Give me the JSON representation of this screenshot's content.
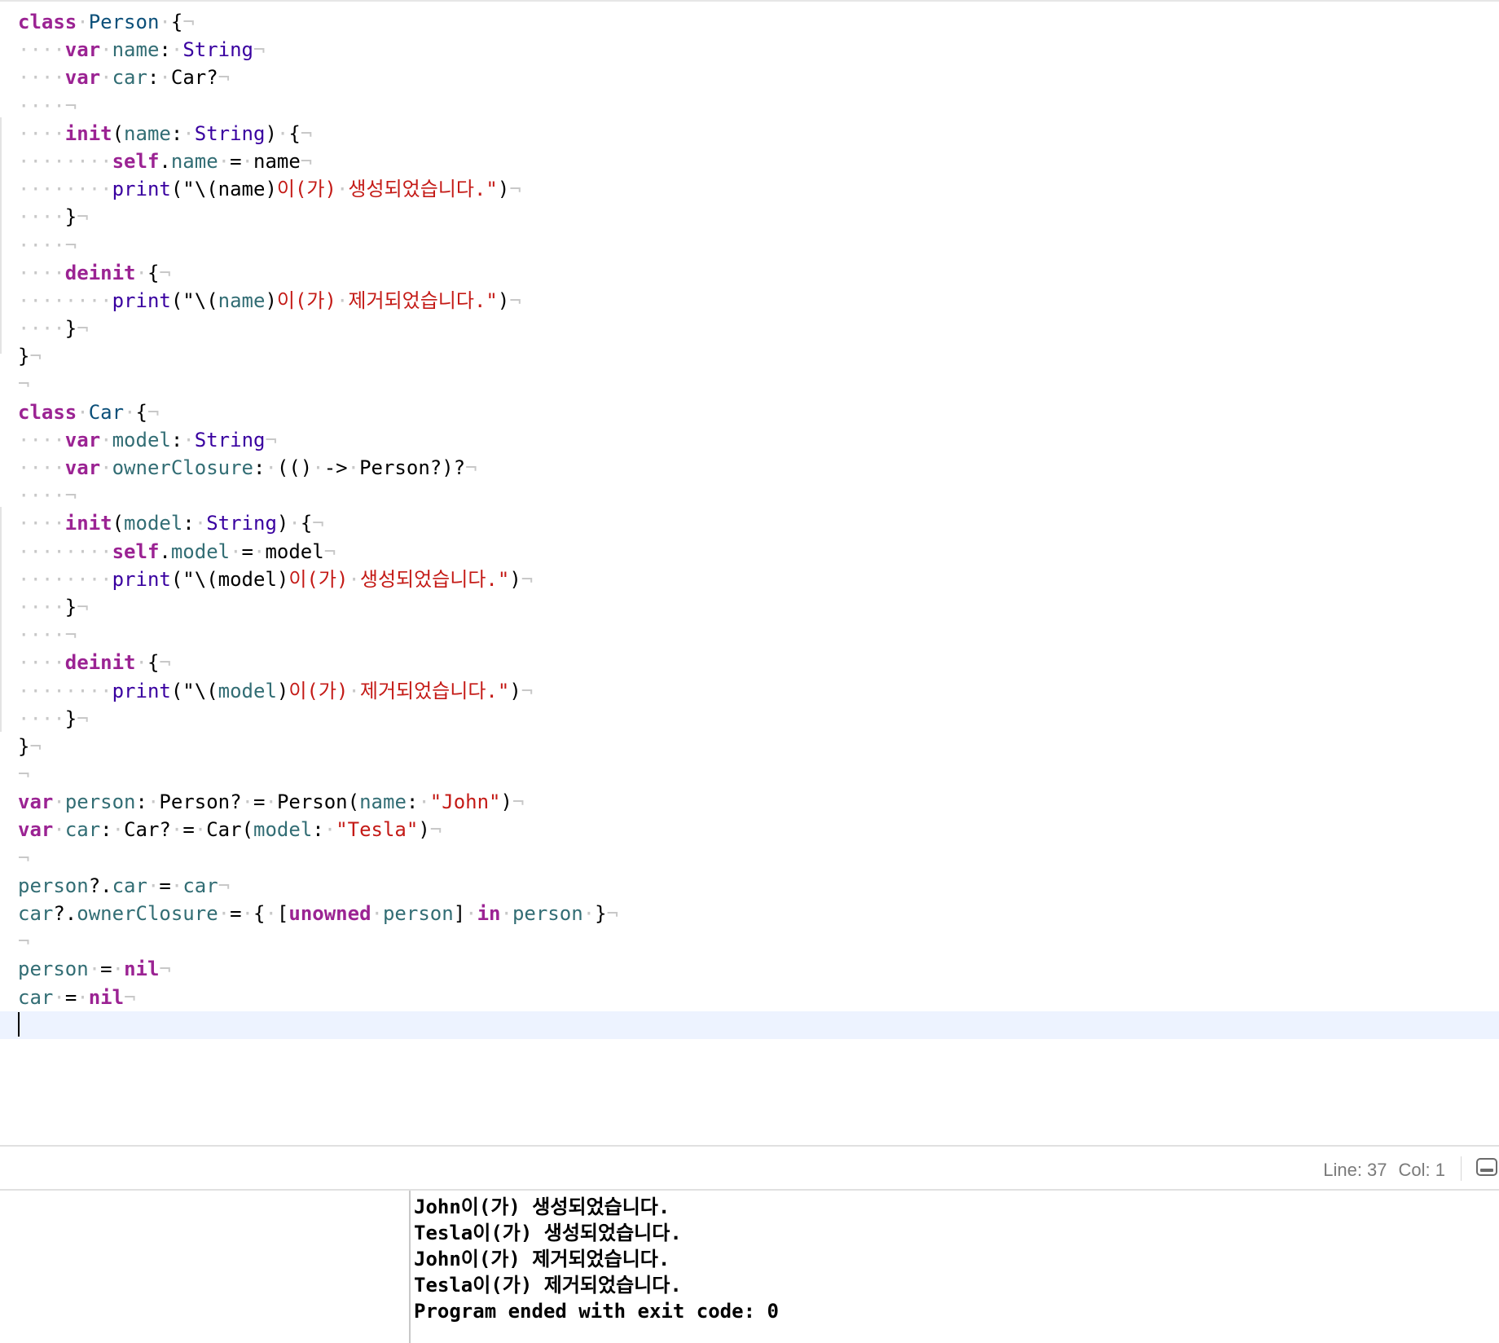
{
  "editor": {
    "code_lines": [
      [
        [
          "kw",
          "class"
        ],
        [
          "ws",
          "·"
        ],
        [
          "ty2",
          "Person"
        ],
        [
          "ws",
          "·"
        ],
        [
          "pl",
          "{"
        ],
        [
          "ws",
          "¬"
        ]
      ],
      [
        [
          "ws",
          "····"
        ],
        [
          "kw",
          "var"
        ],
        [
          "ws",
          "·"
        ],
        [
          "id",
          "name"
        ],
        [
          "pl",
          ":"
        ],
        [
          "ws",
          "·"
        ],
        [
          "ty",
          "String"
        ],
        [
          "ws",
          "¬"
        ]
      ],
      [
        [
          "ws",
          "····"
        ],
        [
          "kw",
          "var"
        ],
        [
          "ws",
          "·"
        ],
        [
          "id",
          "car"
        ],
        [
          "pl",
          ":"
        ],
        [
          "ws",
          "·"
        ],
        [
          "pl",
          "Car?"
        ],
        [
          "ws",
          "¬"
        ]
      ],
      [
        [
          "ws",
          "····¬"
        ]
      ],
      [
        [
          "ws",
          "····"
        ],
        [
          "kw",
          "init"
        ],
        [
          "pl",
          "("
        ],
        [
          "id",
          "name"
        ],
        [
          "pl",
          ":"
        ],
        [
          "ws",
          "·"
        ],
        [
          "ty",
          "String"
        ],
        [
          "pl",
          ")"
        ],
        [
          "ws",
          "·"
        ],
        [
          "pl",
          "{"
        ],
        [
          "ws",
          "¬"
        ]
      ],
      [
        [
          "ws",
          "········"
        ],
        [
          "kw",
          "self"
        ],
        [
          "pl",
          "."
        ],
        [
          "id",
          "name"
        ],
        [
          "ws",
          "·"
        ],
        [
          "pl",
          "="
        ],
        [
          "ws",
          "·"
        ],
        [
          "pl",
          "name"
        ],
        [
          "ws",
          "¬"
        ]
      ],
      [
        [
          "ws",
          "········"
        ],
        [
          "ty",
          "print"
        ],
        [
          "pl",
          "(\"\\(name)"
        ],
        [
          "str",
          "이(가)"
        ],
        [
          "ws",
          "·"
        ],
        [
          "str",
          "생성되었습니다.\""
        ],
        [
          "pl",
          ")"
        ],
        [
          "ws",
          "¬"
        ]
      ],
      [
        [
          "ws",
          "····"
        ],
        [
          "pl",
          "}"
        ],
        [
          "ws",
          "¬"
        ]
      ],
      [
        [
          "ws",
          "····¬"
        ]
      ],
      [
        [
          "ws",
          "····"
        ],
        [
          "kw",
          "deinit"
        ],
        [
          "ws",
          "·"
        ],
        [
          "pl",
          "{"
        ],
        [
          "ws",
          "¬"
        ]
      ],
      [
        [
          "ws",
          "········"
        ],
        [
          "ty",
          "print"
        ],
        [
          "pl",
          "(\"\\("
        ],
        [
          "id",
          "name"
        ],
        [
          "pl",
          ")"
        ],
        [
          "str",
          "이(가)"
        ],
        [
          "ws",
          "·"
        ],
        [
          "str",
          "제거되었습니다.\""
        ],
        [
          "pl",
          ")"
        ],
        [
          "ws",
          "¬"
        ]
      ],
      [
        [
          "ws",
          "····"
        ],
        [
          "pl",
          "}"
        ],
        [
          "ws",
          "¬"
        ]
      ],
      [
        [
          "pl",
          "}"
        ],
        [
          "ws",
          "¬"
        ]
      ],
      [
        [
          "ws",
          "¬"
        ]
      ],
      [
        [
          "kw",
          "class"
        ],
        [
          "ws",
          "·"
        ],
        [
          "ty2",
          "Car"
        ],
        [
          "ws",
          "·"
        ],
        [
          "pl",
          "{"
        ],
        [
          "ws",
          "¬"
        ]
      ],
      [
        [
          "ws",
          "····"
        ],
        [
          "kw",
          "var"
        ],
        [
          "ws",
          "·"
        ],
        [
          "id",
          "model"
        ],
        [
          "pl",
          ":"
        ],
        [
          "ws",
          "·"
        ],
        [
          "ty",
          "String"
        ],
        [
          "ws",
          "¬"
        ]
      ],
      [
        [
          "ws",
          "····"
        ],
        [
          "kw",
          "var"
        ],
        [
          "ws",
          "·"
        ],
        [
          "id",
          "ownerClosure"
        ],
        [
          "pl",
          ":"
        ],
        [
          "ws",
          "·"
        ],
        [
          "pl",
          "(()"
        ],
        [
          "ws",
          "·"
        ],
        [
          "pl",
          "->"
        ],
        [
          "ws",
          "·"
        ],
        [
          "pl",
          "Person?)?"
        ],
        [
          "ws",
          "¬"
        ]
      ],
      [
        [
          "ws",
          "····¬"
        ]
      ],
      [
        [
          "ws",
          "····"
        ],
        [
          "kw",
          "init"
        ],
        [
          "pl",
          "("
        ],
        [
          "id",
          "model"
        ],
        [
          "pl",
          ":"
        ],
        [
          "ws",
          "·"
        ],
        [
          "ty",
          "String"
        ],
        [
          "pl",
          ")"
        ],
        [
          "ws",
          "·"
        ],
        [
          "pl",
          "{"
        ],
        [
          "ws",
          "¬"
        ]
      ],
      [
        [
          "ws",
          "········"
        ],
        [
          "kw",
          "self"
        ],
        [
          "pl",
          "."
        ],
        [
          "id",
          "model"
        ],
        [
          "ws",
          "·"
        ],
        [
          "pl",
          "="
        ],
        [
          "ws",
          "·"
        ],
        [
          "pl",
          "model"
        ],
        [
          "ws",
          "¬"
        ]
      ],
      [
        [
          "ws",
          "········"
        ],
        [
          "ty",
          "print"
        ],
        [
          "pl",
          "(\"\\(model)"
        ],
        [
          "str",
          "이(가)"
        ],
        [
          "ws",
          "·"
        ],
        [
          "str",
          "생성되었습니다.\""
        ],
        [
          "pl",
          ")"
        ],
        [
          "ws",
          "¬"
        ]
      ],
      [
        [
          "ws",
          "····"
        ],
        [
          "pl",
          "}"
        ],
        [
          "ws",
          "¬"
        ]
      ],
      [
        [
          "ws",
          "····¬"
        ]
      ],
      [
        [
          "ws",
          "····"
        ],
        [
          "kw",
          "deinit"
        ],
        [
          "ws",
          "·"
        ],
        [
          "pl",
          "{"
        ],
        [
          "ws",
          "¬"
        ]
      ],
      [
        [
          "ws",
          "········"
        ],
        [
          "ty",
          "print"
        ],
        [
          "pl",
          "(\"\\("
        ],
        [
          "id",
          "model"
        ],
        [
          "pl",
          ")"
        ],
        [
          "str",
          "이(가)"
        ],
        [
          "ws",
          "·"
        ],
        [
          "str",
          "제거되었습니다.\""
        ],
        [
          "pl",
          ")"
        ],
        [
          "ws",
          "¬"
        ]
      ],
      [
        [
          "ws",
          "····"
        ],
        [
          "pl",
          "}"
        ],
        [
          "ws",
          "¬"
        ]
      ],
      [
        [
          "pl",
          "}"
        ],
        [
          "ws",
          "¬"
        ]
      ],
      [
        [
          "ws",
          "¬"
        ]
      ],
      [
        [
          "kw",
          "var"
        ],
        [
          "ws",
          "·"
        ],
        [
          "id",
          "person"
        ],
        [
          "pl",
          ":"
        ],
        [
          "ws",
          "·"
        ],
        [
          "pl",
          "Person?"
        ],
        [
          "ws",
          "·"
        ],
        [
          "pl",
          "="
        ],
        [
          "ws",
          "·"
        ],
        [
          "pl",
          "Person("
        ],
        [
          "id",
          "name"
        ],
        [
          "pl",
          ":"
        ],
        [
          "ws",
          "·"
        ],
        [
          "str",
          "\"John\""
        ],
        [
          "pl",
          ")"
        ],
        [
          "ws",
          "¬"
        ]
      ],
      [
        [
          "kw",
          "var"
        ],
        [
          "ws",
          "·"
        ],
        [
          "id",
          "car"
        ],
        [
          "pl",
          ":"
        ],
        [
          "ws",
          "·"
        ],
        [
          "pl",
          "Car?"
        ],
        [
          "ws",
          "·"
        ],
        [
          "pl",
          "="
        ],
        [
          "ws",
          "·"
        ],
        [
          "pl",
          "Car("
        ],
        [
          "id",
          "model"
        ],
        [
          "pl",
          ":"
        ],
        [
          "ws",
          "·"
        ],
        [
          "str",
          "\"Tesla\""
        ],
        [
          "pl",
          ")"
        ],
        [
          "ws",
          "¬"
        ]
      ],
      [
        [
          "ws",
          "¬"
        ]
      ],
      [
        [
          "id",
          "person"
        ],
        [
          "pl",
          "?."
        ],
        [
          "id",
          "car"
        ],
        [
          "ws",
          "·"
        ],
        [
          "pl",
          "="
        ],
        [
          "ws",
          "·"
        ],
        [
          "id",
          "car"
        ],
        [
          "ws",
          "¬"
        ]
      ],
      [
        [
          "id",
          "car"
        ],
        [
          "pl",
          "?."
        ],
        [
          "id",
          "ownerClosure"
        ],
        [
          "ws",
          "·"
        ],
        [
          "pl",
          "="
        ],
        [
          "ws",
          "·"
        ],
        [
          "pl",
          "{"
        ],
        [
          "ws",
          "·"
        ],
        [
          "pl",
          "["
        ],
        [
          "kw",
          "unowned"
        ],
        [
          "ws",
          "·"
        ],
        [
          "id",
          "person"
        ],
        [
          "pl",
          "]"
        ],
        [
          "ws",
          "·"
        ],
        [
          "kw",
          "in"
        ],
        [
          "ws",
          "·"
        ],
        [
          "id",
          "person"
        ],
        [
          "ws",
          "·"
        ],
        [
          "pl",
          "}"
        ],
        [
          "ws",
          "¬"
        ]
      ],
      [
        [
          "ws",
          "¬"
        ]
      ],
      [
        [
          "id",
          "person"
        ],
        [
          "ws",
          "·"
        ],
        [
          "pl",
          "="
        ],
        [
          "ws",
          "·"
        ],
        [
          "kw",
          "nil"
        ],
        [
          "ws",
          "¬"
        ]
      ],
      [
        [
          "id",
          "car"
        ],
        [
          "ws",
          "·"
        ],
        [
          "pl",
          "="
        ],
        [
          "ws",
          "·"
        ],
        [
          "kw",
          "nil"
        ],
        [
          "ws",
          "¬"
        ]
      ],
      []
    ]
  },
  "status_bar": {
    "line": "Line: 37",
    "col": "Col: 1"
  },
  "console": {
    "lines": [
      "John이(가) 생성되었습니다.",
      "Tesla이(가) 생성되었습니다.",
      "John이(가) 제거되었습니다.",
      "Tesla이(가) 제거되었습니다.",
      "Program ended with exit code: 0"
    ]
  }
}
